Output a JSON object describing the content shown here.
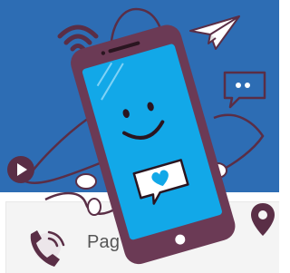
{
  "card": {
    "label": "Pag"
  },
  "icons": {
    "wifi": "wifi-icon",
    "plane": "paper-plane-icon",
    "chat": "chat-bubble-icon",
    "play": "play-icon",
    "pin": "location-pin-icon",
    "call": "phone-call-icon",
    "heart": "heart-icon"
  },
  "colors": {
    "hero_background": "#2d6db4",
    "phone_body": "#6b3a55",
    "phone_screen": "#12a8e8",
    "accent_dark": "#5a2e46",
    "white": "#ffffff"
  }
}
